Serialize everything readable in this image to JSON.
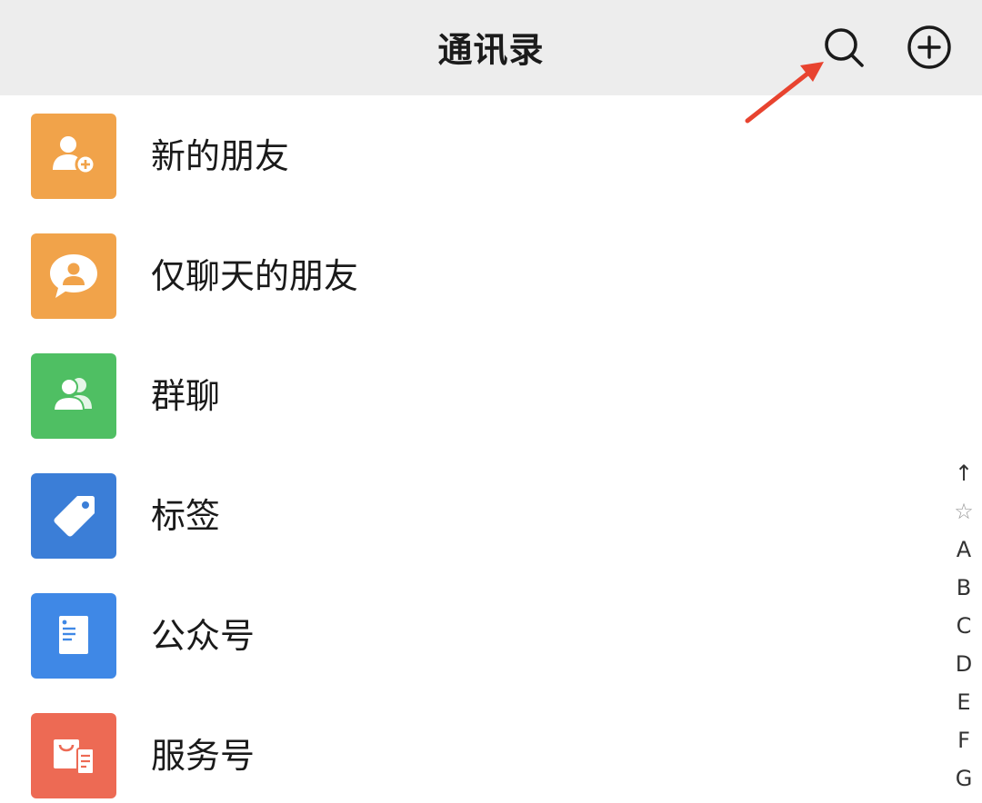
{
  "header": {
    "title": "通讯录"
  },
  "items": [
    {
      "label": "新的朋友",
      "icon": "add-friend-icon",
      "color": "#f1a34a"
    },
    {
      "label": "仅聊天的朋友",
      "icon": "chat-only-friend-icon",
      "color": "#f1a34a"
    },
    {
      "label": "群聊",
      "icon": "group-chat-icon",
      "color": "#4fbf63"
    },
    {
      "label": "标签",
      "icon": "tag-icon",
      "color": "#3b7ed7"
    },
    {
      "label": "公众号",
      "icon": "official-account-icon",
      "color": "#3f88e6"
    },
    {
      "label": "服务号",
      "icon": "service-account-icon",
      "color": "#ed6a54"
    }
  ],
  "index": [
    "↑",
    "☆",
    "A",
    "B",
    "C",
    "D",
    "E",
    "F",
    "G"
  ],
  "colors": {
    "header_bg": "#ededed",
    "annotation_arrow": "#e8432f"
  }
}
